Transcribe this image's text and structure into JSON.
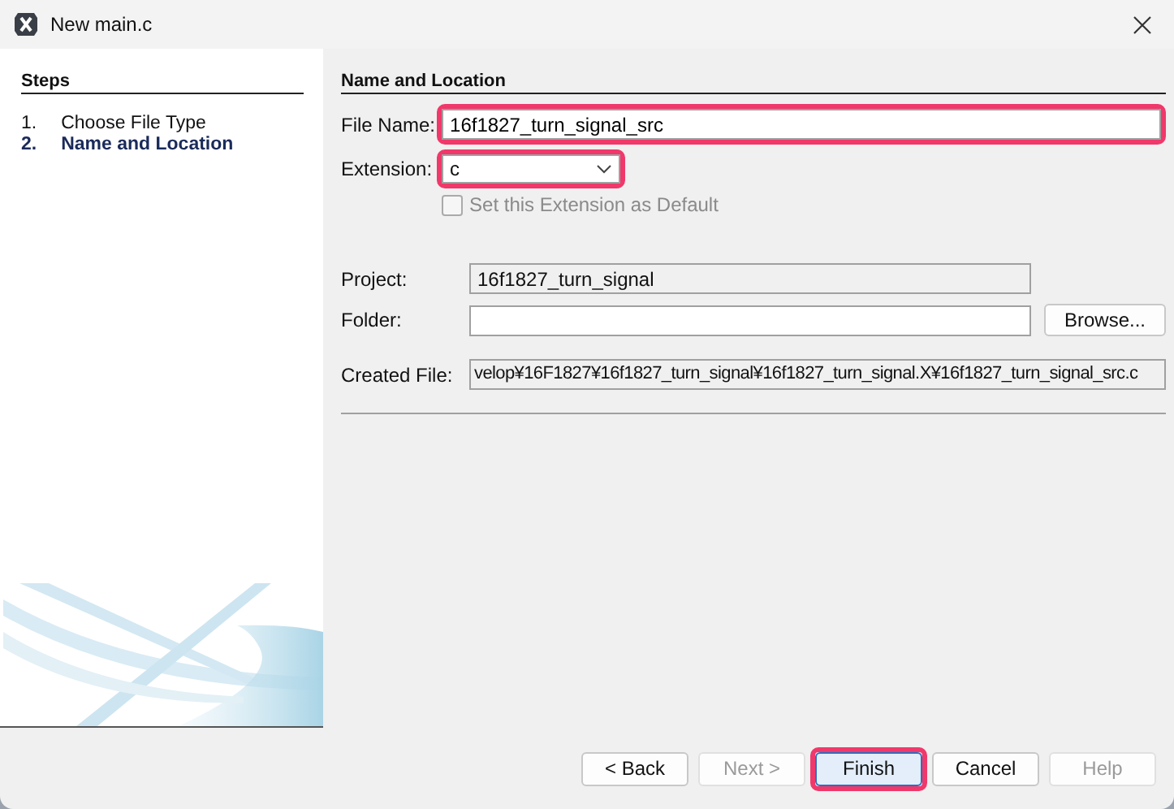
{
  "window": {
    "title": "New main.c"
  },
  "steps": {
    "title": "Steps",
    "items": [
      {
        "number": "1.",
        "label": "Choose File Type",
        "selected": false
      },
      {
        "number": "2.",
        "label": "Name and Location",
        "selected": true
      }
    ]
  },
  "panel": {
    "title": "Name and Location",
    "file_name": {
      "label": "File Name:",
      "value": "16f1827_turn_signal_src",
      "highlighted": true
    },
    "extension": {
      "label": "Extension:",
      "value": "c",
      "highlighted": true
    },
    "default_checkbox": {
      "label": "Set this Extension as Default",
      "checked": false,
      "disabled": true
    },
    "project": {
      "label": "Project:",
      "value": "16f1827_turn_signal"
    },
    "folder": {
      "label": "Folder:",
      "browse": "Browse..."
    },
    "created_file": {
      "label": "Created File:",
      "value": "velop¥16F1827¥16f1827_turn_signal¥16f1827_turn_signal.X¥16f1827_turn_signal_src.c"
    }
  },
  "buttons": [
    {
      "label": "< Back",
      "disabled": false,
      "default": false,
      "highlighted": false
    },
    {
      "label": "Next >",
      "disabled": true,
      "default": false,
      "highlighted": false
    },
    {
      "label": "Finish",
      "disabled": false,
      "default": true,
      "highlighted": true
    },
    {
      "label": "Cancel",
      "disabled": false,
      "default": false,
      "highlighted": false
    },
    {
      "label": "Help",
      "disabled": true,
      "default": false,
      "highlighted": false
    }
  ]
}
